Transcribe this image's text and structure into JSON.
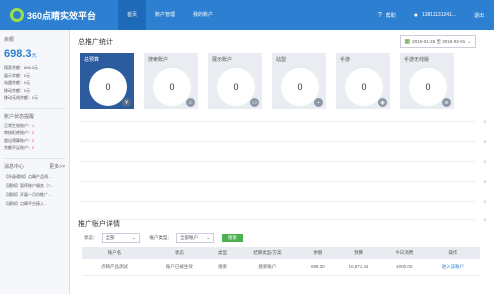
{
  "app": {
    "logo_text": "360点睛实效平台"
  },
  "nav": {
    "items": [
      "首页",
      "账户管理",
      "我的账户"
    ]
  },
  "topright": {
    "help": "帮助",
    "user": "13811131241...",
    "logout": "退出"
  },
  "sidebar": {
    "balance_label": "余额",
    "balance_value": "698.3",
    "balance_unit": "元",
    "lines": [
      "搜索余额：698.3元",
      "展示余额：0元",
      "站盟余额：0元",
      "移动余额：0元",
      "移动无线余额：0元"
    ],
    "status_title": "账户状态提醒",
    "status_lines": [
      {
        "label": "正常生效账户：",
        "value": "1"
      },
      {
        "label": "审核拒绝账户：",
        "value": "0"
      },
      {
        "label": "超出预算账户：",
        "value": "0"
      },
      {
        "label": "余额不足账户：",
        "value": "0"
      }
    ],
    "msg_title": "消息中心",
    "msg_more": "更多>>",
    "messages": [
      "【升级通知】点睛产品线...",
      "【通知】暂停账户服务（7...",
      "【通知】开展一月份推广...",
      "【通知】点睛平台接入..."
    ]
  },
  "overview": {
    "title": "总推广统计",
    "date_range": "2015-01-26 至 2015-02-01",
    "cards": [
      {
        "title": "总预算",
        "value": "0"
      },
      {
        "title": "搜索账户",
        "value": "0"
      },
      {
        "title": "展示账户",
        "value": "0"
      },
      {
        "title": "站盟",
        "value": "0"
      },
      {
        "title": "手游",
        "value": "0"
      },
      {
        "title": "手游无线版",
        "value": "0"
      }
    ],
    "axis": [
      "0",
      "0",
      "0",
      "0",
      "0",
      "0"
    ]
  },
  "detail": {
    "title": "推广账户详情",
    "filter_status_label": "状态：",
    "filter_status_value": "全部",
    "filter_type_label": "账户类型：",
    "filter_type_value": "全部账户",
    "search_label": "搜索",
    "columns": [
      "账户名",
      "状态",
      "类型",
      "结算类型/方案",
      "余额",
      "预算",
      "今日消费",
      "操作"
    ],
    "rows": [
      [
        "点睛产品测试",
        "账户已被生效",
        "搜索",
        "搜索账户",
        "698.30",
        "10,871.44",
        "4000.00",
        "进入该账户"
      ]
    ]
  }
}
